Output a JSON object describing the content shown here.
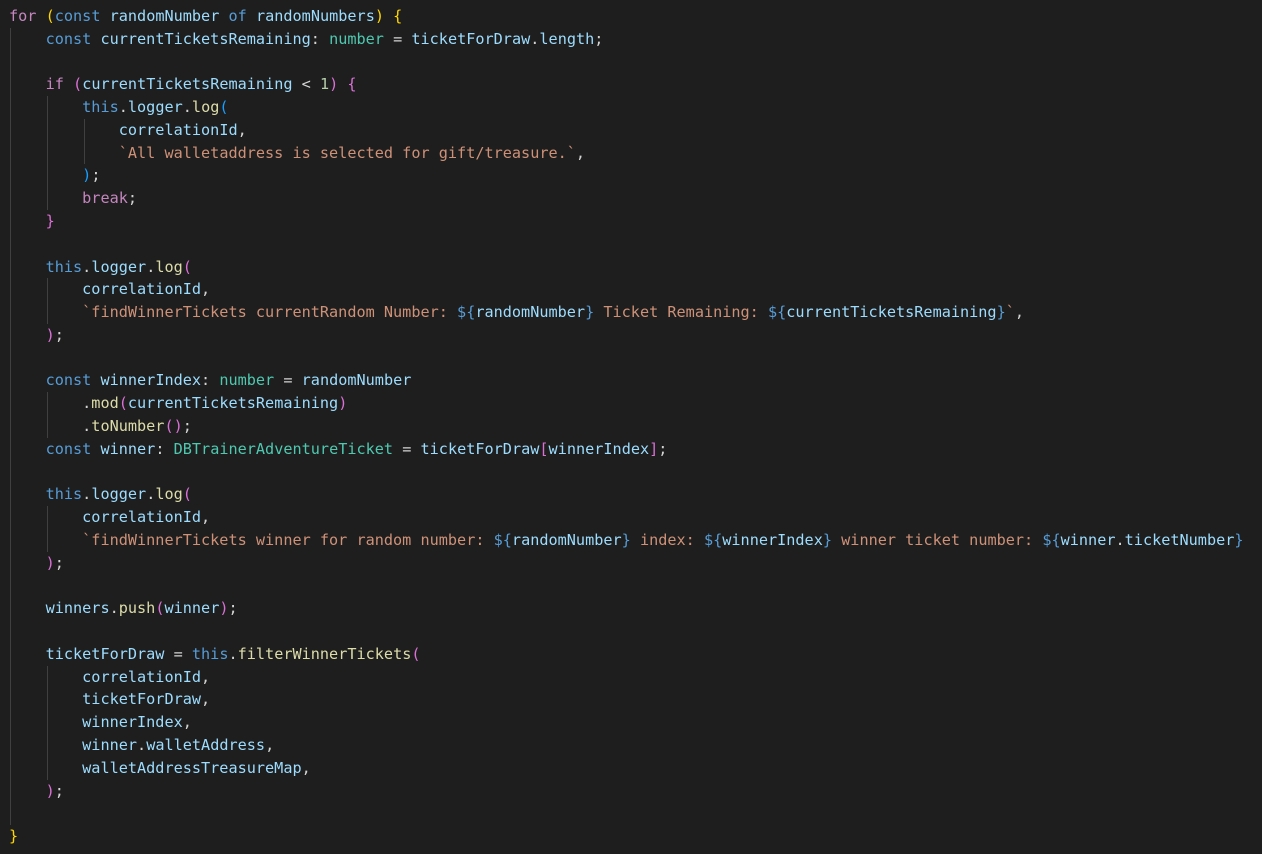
{
  "editor": {
    "language": "typescript",
    "theme_colors": {
      "background": "#1e1e1e",
      "keyword_control": "#c586c0",
      "keyword_storage": "#569cd6",
      "variable": "#9cdcfe",
      "type": "#4ec9b0",
      "function": "#dcdcaa",
      "string": "#ce9178",
      "number": "#b5cea8",
      "bracket_level_1": "#ffd700",
      "bracket_level_2": "#da70d6",
      "bracket_level_3": "#179fff"
    },
    "lines": [
      [
        [
          "kw",
          "for"
        ],
        [
          "op",
          " "
        ],
        [
          "b1",
          "("
        ],
        [
          "st",
          "const"
        ],
        [
          "op",
          " "
        ],
        [
          "var",
          "randomNumber"
        ],
        [
          "op",
          " "
        ],
        [
          "st",
          "of"
        ],
        [
          "op",
          " "
        ],
        [
          "var",
          "randomNumbers"
        ],
        [
          "b1",
          ")"
        ],
        [
          "op",
          " "
        ],
        [
          "b1",
          "{"
        ]
      ],
      [
        [
          "op",
          "    "
        ],
        [
          "st",
          "const"
        ],
        [
          "op",
          " "
        ],
        [
          "var",
          "currentTicketsRemaining"
        ],
        [
          "op",
          ": "
        ],
        [
          "typ",
          "number"
        ],
        [
          "op",
          " = "
        ],
        [
          "var",
          "ticketForDraw"
        ],
        [
          "op",
          "."
        ],
        [
          "var",
          "length"
        ],
        [
          "op",
          ";"
        ]
      ],
      [
        [
          "op",
          ""
        ]
      ],
      [
        [
          "op",
          "    "
        ],
        [
          "kw",
          "if"
        ],
        [
          "op",
          " "
        ],
        [
          "b2",
          "("
        ],
        [
          "var",
          "currentTicketsRemaining"
        ],
        [
          "op",
          " < "
        ],
        [
          "num",
          "1"
        ],
        [
          "b2",
          ")"
        ],
        [
          "op",
          " "
        ],
        [
          "b2",
          "{"
        ]
      ],
      [
        [
          "op",
          "        "
        ],
        [
          "st",
          "this"
        ],
        [
          "op",
          "."
        ],
        [
          "var",
          "logger"
        ],
        [
          "op",
          "."
        ],
        [
          "fn",
          "log"
        ],
        [
          "b3",
          "("
        ]
      ],
      [
        [
          "op",
          "            "
        ],
        [
          "var",
          "correlationId"
        ],
        [
          "op",
          ","
        ]
      ],
      [
        [
          "op",
          "            "
        ],
        [
          "str",
          "`All walletaddress is selected for gift/treasure.`"
        ],
        [
          "op",
          ","
        ]
      ],
      [
        [
          "op",
          "        "
        ],
        [
          "b3",
          ")"
        ],
        [
          "op",
          ";"
        ]
      ],
      [
        [
          "op",
          "        "
        ],
        [
          "kw",
          "break"
        ],
        [
          "op",
          ";"
        ]
      ],
      [
        [
          "op",
          "    "
        ],
        [
          "b2",
          "}"
        ]
      ],
      [
        [
          "op",
          ""
        ]
      ],
      [
        [
          "op",
          "    "
        ],
        [
          "st",
          "this"
        ],
        [
          "op",
          "."
        ],
        [
          "var",
          "logger"
        ],
        [
          "op",
          "."
        ],
        [
          "fn",
          "log"
        ],
        [
          "b2",
          "("
        ]
      ],
      [
        [
          "op",
          "        "
        ],
        [
          "var",
          "correlationId"
        ],
        [
          "op",
          ","
        ]
      ],
      [
        [
          "op",
          "        "
        ],
        [
          "str",
          "`findWinnerTickets currentRandom Number: "
        ],
        [
          "st",
          "${"
        ],
        [
          "var",
          "randomNumber"
        ],
        [
          "st",
          "}"
        ],
        [
          "str",
          " Ticket Remaining: "
        ],
        [
          "st",
          "${"
        ],
        [
          "var",
          "currentTicketsRemaining"
        ],
        [
          "st",
          "}"
        ],
        [
          "str",
          "`"
        ],
        [
          "op",
          ","
        ]
      ],
      [
        [
          "op",
          "    "
        ],
        [
          "b2",
          ")"
        ],
        [
          "op",
          ";"
        ]
      ],
      [
        [
          "op",
          ""
        ]
      ],
      [
        [
          "op",
          "    "
        ],
        [
          "st",
          "const"
        ],
        [
          "op",
          " "
        ],
        [
          "var",
          "winnerIndex"
        ],
        [
          "op",
          ": "
        ],
        [
          "typ",
          "number"
        ],
        [
          "op",
          " = "
        ],
        [
          "var",
          "randomNumber"
        ]
      ],
      [
        [
          "op",
          "        ."
        ],
        [
          "fn",
          "mod"
        ],
        [
          "b2",
          "("
        ],
        [
          "var",
          "currentTicketsRemaining"
        ],
        [
          "b2",
          ")"
        ]
      ],
      [
        [
          "op",
          "        ."
        ],
        [
          "fn",
          "toNumber"
        ],
        [
          "b2",
          "()"
        ],
        [
          "op",
          ";"
        ]
      ],
      [
        [
          "op",
          "    "
        ],
        [
          "st",
          "const"
        ],
        [
          "op",
          " "
        ],
        [
          "var",
          "winner"
        ],
        [
          "op",
          ": "
        ],
        [
          "typ",
          "DBTrainerAdventureTicket"
        ],
        [
          "op",
          " = "
        ],
        [
          "var",
          "ticketForDraw"
        ],
        [
          "b2",
          "["
        ],
        [
          "var",
          "winnerIndex"
        ],
        [
          "b2",
          "]"
        ],
        [
          "op",
          ";"
        ]
      ],
      [
        [
          "op",
          ""
        ]
      ],
      [
        [
          "op",
          "    "
        ],
        [
          "st",
          "this"
        ],
        [
          "op",
          "."
        ],
        [
          "var",
          "logger"
        ],
        [
          "op",
          "."
        ],
        [
          "fn",
          "log"
        ],
        [
          "b2",
          "("
        ]
      ],
      [
        [
          "op",
          "        "
        ],
        [
          "var",
          "correlationId"
        ],
        [
          "op",
          ","
        ]
      ],
      [
        [
          "op",
          "        "
        ],
        [
          "str",
          "`findWinnerTickets winner for random number: "
        ],
        [
          "st",
          "${"
        ],
        [
          "var",
          "randomNumber"
        ],
        [
          "st",
          "}"
        ],
        [
          "str",
          " index: "
        ],
        [
          "st",
          "${"
        ],
        [
          "var",
          "winnerIndex"
        ],
        [
          "st",
          "}"
        ],
        [
          "str",
          " winner ticket number: "
        ],
        [
          "st",
          "${"
        ],
        [
          "var",
          "winner"
        ],
        [
          "op",
          "."
        ],
        [
          "var",
          "ticketNumber"
        ],
        [
          "st",
          "}"
        ]
      ],
      [
        [
          "op",
          "    "
        ],
        [
          "b2",
          ")"
        ],
        [
          "op",
          ";"
        ]
      ],
      [
        [
          "op",
          ""
        ]
      ],
      [
        [
          "op",
          "    "
        ],
        [
          "var",
          "winners"
        ],
        [
          "op",
          "."
        ],
        [
          "fn",
          "push"
        ],
        [
          "b2",
          "("
        ],
        [
          "var",
          "winner"
        ],
        [
          "b2",
          ")"
        ],
        [
          "op",
          ";"
        ]
      ],
      [
        [
          "op",
          ""
        ]
      ],
      [
        [
          "op",
          "    "
        ],
        [
          "var",
          "ticketForDraw"
        ],
        [
          "op",
          " = "
        ],
        [
          "st",
          "this"
        ],
        [
          "op",
          "."
        ],
        [
          "fn",
          "filterWinnerTickets"
        ],
        [
          "b2",
          "("
        ]
      ],
      [
        [
          "op",
          "        "
        ],
        [
          "var",
          "correlationId"
        ],
        [
          "op",
          ","
        ]
      ],
      [
        [
          "op",
          "        "
        ],
        [
          "var",
          "ticketForDraw"
        ],
        [
          "op",
          ","
        ]
      ],
      [
        [
          "op",
          "        "
        ],
        [
          "var",
          "winnerIndex"
        ],
        [
          "op",
          ","
        ]
      ],
      [
        [
          "op",
          "        "
        ],
        [
          "var",
          "winner"
        ],
        [
          "op",
          "."
        ],
        [
          "var",
          "walletAddress"
        ],
        [
          "op",
          ","
        ]
      ],
      [
        [
          "op",
          "        "
        ],
        [
          "var",
          "walletAddressTreasureMap"
        ],
        [
          "op",
          ","
        ]
      ],
      [
        [
          "op",
          "    "
        ],
        [
          "b2",
          ")"
        ],
        [
          "op",
          ";"
        ]
      ],
      [
        [
          "op",
          ""
        ]
      ],
      [
        [
          "b1",
          "}"
        ]
      ],
      [
        [
          "op",
          "        .    .      .   .   .   .       .   ."
        ]
      ]
    ]
  }
}
